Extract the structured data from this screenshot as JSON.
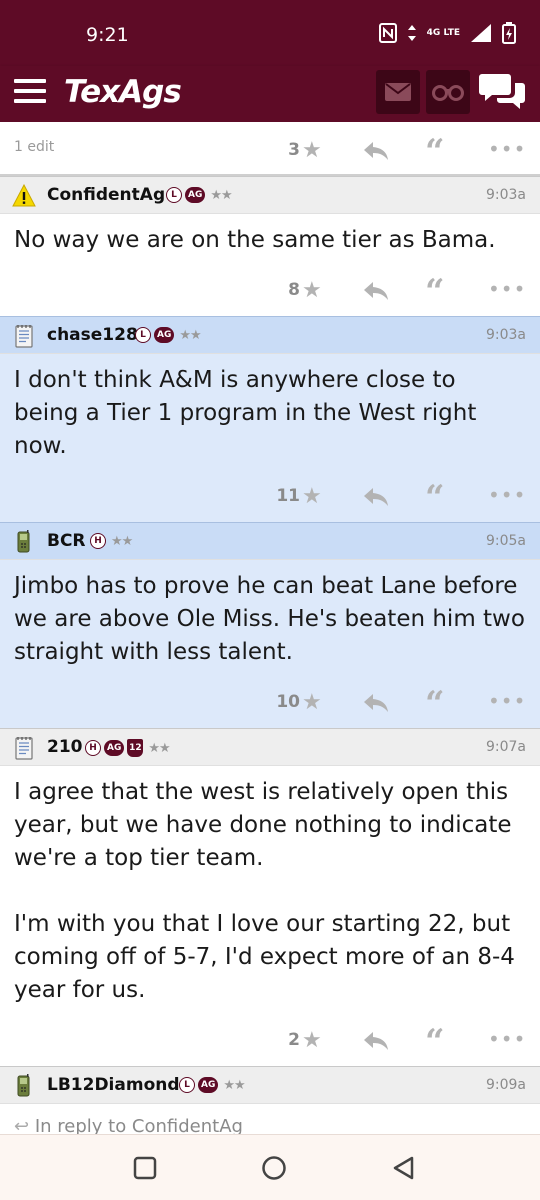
{
  "status": {
    "time": "9:21",
    "network": "4G LTE"
  },
  "appbar": {
    "logo": "TexAgs"
  },
  "prev_post": {
    "edit": "1 edit",
    "count": "3"
  },
  "posts": [
    {
      "user": "ConfidentAg",
      "time": "9:03a",
      "body": "No way we are on the same tier as Bama.",
      "count": "8",
      "icon": "warning-icon",
      "badges": [
        "L",
        "AG"
      ]
    },
    {
      "user": "chase128",
      "time": "9:03a",
      "body": "I don't think A&M is anywhere close to being a Tier 1 program in the West right now.",
      "count": "11",
      "icon": "notepad-icon",
      "badges": [
        "L",
        "AG"
      ]
    },
    {
      "user": "BCR",
      "time": "9:05a",
      "body": "Jimbo has to prove he can beat Lane before we are above Ole Miss. He's beaten him two straight with less talent.",
      "count": "10",
      "icon": "phone-icon",
      "badges": [
        "H"
      ]
    },
    {
      "user": "210",
      "time": "9:07a",
      "body": "I agree that the west is relatively open this year, but we have done nothing to indicate we're a top tier team.\n\nI'm with you that I love our starting 22, but coming off of 5-7, I'd expect more of an 8-4 year for us.",
      "count": "2",
      "icon": "notepad-icon",
      "badges": [
        "H",
        "AG",
        "12"
      ]
    },
    {
      "user": "LB12Diamond",
      "time": "9:09a",
      "reply_to": "In reply to ConfidentAg",
      "icon": "phone-icon",
      "badges": [
        "L",
        "AG"
      ]
    }
  ],
  "stars_glyph": "★★",
  "colors": {
    "maroon": "#5e0b26",
    "highlight": "#dde9fa"
  }
}
